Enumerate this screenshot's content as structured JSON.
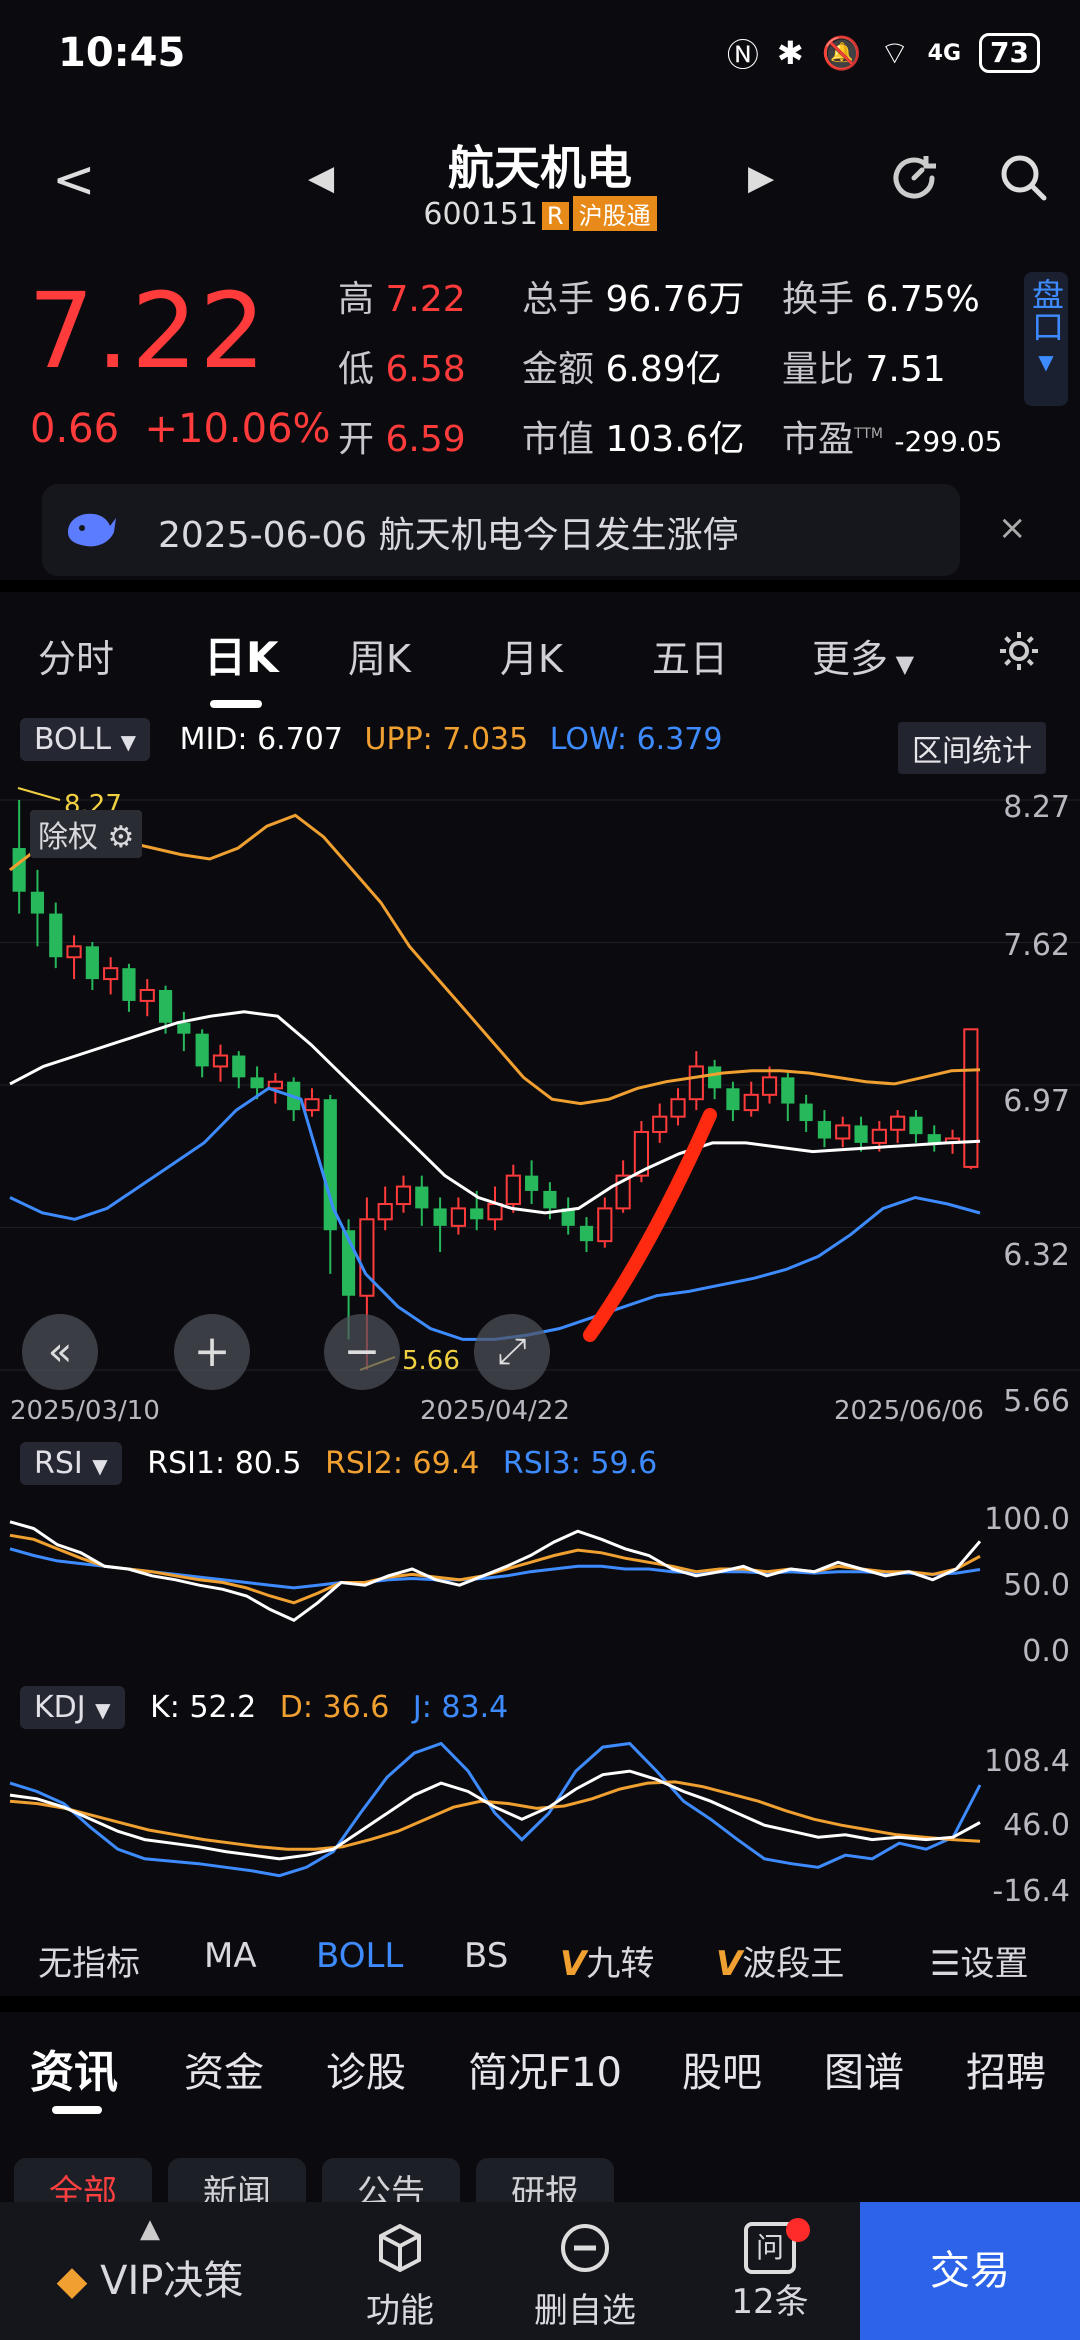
{
  "status": {
    "time": "10:45",
    "network": "4G",
    "battery": "73"
  },
  "header": {
    "name": "航天机电",
    "code": "600151",
    "tag_r": "R",
    "tag_connect": "沪股通"
  },
  "quote": {
    "price": "7.22",
    "change": "0.66",
    "change_pct": "+10.06%",
    "high_label": "高",
    "high": "7.22",
    "low_label": "低",
    "low": "6.58",
    "open_label": "开",
    "open": "6.59",
    "vol_label": "总手",
    "vol": "96.76万",
    "amount_label": "金额",
    "amount": "6.89亿",
    "mcap_label": "市值",
    "mcap": "103.6亿",
    "turnover_label": "换手",
    "turnover": "6.75%",
    "volratio_label": "量比",
    "volratio": "7.51",
    "pe_label": "市盈",
    "pe_sup": "TTM",
    "pe": "-299.05",
    "pankou": "盘口"
  },
  "notice": {
    "text": "2025-06-06 航天机电今日发生涨停",
    "close": "×"
  },
  "chart_tabs": [
    "分时",
    "日K",
    "周K",
    "月K",
    "五日",
    "更多"
  ],
  "boll": {
    "indicator": "BOLL",
    "mid_label": "MID:",
    "mid": "6.707",
    "upp_label": "UPP:",
    "upp": "7.035",
    "low_label": "LOW:",
    "low": "6.379",
    "range_btn": "区间统计",
    "chuquan": "除权",
    "max_mark": "8.27",
    "min_mark": "5.66",
    "y_ticks": [
      "8.27",
      "7.62",
      "6.97",
      "6.32",
      "5.66"
    ],
    "x_dates": [
      "2025/03/10",
      "2025/04/22",
      "2025/06/06"
    ]
  },
  "rsi": {
    "indicator": "RSI",
    "rsi1_label": "RSI1:",
    "rsi1": "80.5",
    "rsi2_label": "RSI2:",
    "rsi2": "69.4",
    "rsi3_label": "RSI3:",
    "rsi3": "59.6",
    "y_ticks": [
      "100.0",
      "50.0",
      "0.0"
    ]
  },
  "kdj": {
    "indicator": "KDJ",
    "k_label": "K:",
    "k": "52.2",
    "d_label": "D:",
    "d": "36.6",
    "j_label": "J:",
    "j": "83.4",
    "y_ticks": [
      "108.4",
      "46.0",
      "-16.4"
    ]
  },
  "indicator_bar": [
    "无指标",
    "MA",
    "BOLL",
    "BS",
    "九转",
    "波段王",
    "设置"
  ],
  "bottom_tabs": [
    "资讯",
    "资金",
    "诊股",
    "简况F10",
    "股吧",
    "图谱",
    "招聘"
  ],
  "sub_tabs": [
    "全部",
    "新闻",
    "公告",
    "研报"
  ],
  "nav": {
    "vip": "VIP决策",
    "func": "功能",
    "delete": "删自选",
    "ask": "12条",
    "ask_icon": "问",
    "trade": "交易"
  },
  "colors": {
    "up": "#ff3b3b",
    "down": "#26b85a",
    "upper": "#f0a030",
    "mid": "#ffffff",
    "lower": "#3d8bff",
    "accent": "#2c63e8"
  },
  "chart_data": {
    "type": "candlestick",
    "ylim": [
      5.66,
      8.27
    ],
    "candles": [
      [
        8.05,
        7.85,
        8.27,
        7.75
      ],
      [
        7.85,
        7.75,
        7.95,
        7.6
      ],
      [
        7.75,
        7.55,
        7.8,
        7.5
      ],
      [
        7.55,
        7.6,
        7.65,
        7.45
      ],
      [
        7.6,
        7.45,
        7.62,
        7.4
      ],
      [
        7.45,
        7.5,
        7.55,
        7.38
      ],
      [
        7.5,
        7.35,
        7.52,
        7.3
      ],
      [
        7.35,
        7.4,
        7.45,
        7.28
      ],
      [
        7.4,
        7.25,
        7.42,
        7.2
      ],
      [
        7.25,
        7.2,
        7.3,
        7.12
      ],
      [
        7.2,
        7.05,
        7.22,
        7.0
      ],
      [
        7.05,
        7.1,
        7.15,
        6.98
      ],
      [
        7.1,
        7.0,
        7.12,
        6.95
      ],
      [
        7.0,
        6.95,
        7.05,
        6.9
      ],
      [
        6.95,
        6.98,
        7.02,
        6.88
      ],
      [
        6.98,
        6.85,
        7.0,
        6.8
      ],
      [
        6.85,
        6.9,
        6.95,
        6.82
      ],
      [
        6.9,
        6.3,
        6.92,
        6.1
      ],
      [
        6.3,
        6.0,
        6.35,
        5.8
      ],
      [
        6.0,
        6.35,
        6.45,
        5.66
      ],
      [
        6.35,
        6.42,
        6.5,
        6.3
      ],
      [
        6.42,
        6.5,
        6.55,
        6.38
      ],
      [
        6.5,
        6.4,
        6.55,
        6.32
      ],
      [
        6.4,
        6.32,
        6.45,
        6.2
      ],
      [
        6.32,
        6.4,
        6.45,
        6.28
      ],
      [
        6.4,
        6.35,
        6.48,
        6.3
      ],
      [
        6.35,
        6.42,
        6.5,
        6.3
      ],
      [
        6.42,
        6.55,
        6.6,
        6.38
      ],
      [
        6.55,
        6.48,
        6.62,
        6.42
      ],
      [
        6.48,
        6.4,
        6.52,
        6.35
      ],
      [
        6.4,
        6.32,
        6.45,
        6.28
      ],
      [
        6.32,
        6.25,
        6.36,
        6.2
      ],
      [
        6.25,
        6.4,
        6.45,
        6.22
      ],
      [
        6.4,
        6.55,
        6.62,
        6.38
      ],
      [
        6.55,
        6.75,
        6.8,
        6.52
      ],
      [
        6.75,
        6.82,
        6.88,
        6.7
      ],
      [
        6.82,
        6.9,
        6.95,
        6.78
      ],
      [
        6.9,
        7.05,
        7.12,
        6.85
      ],
      [
        7.05,
        6.95,
        7.08,
        6.9
      ],
      [
        6.95,
        6.85,
        6.98,
        6.8
      ],
      [
        6.85,
        6.92,
        6.98,
        6.82
      ],
      [
        6.92,
        7.0,
        7.05,
        6.88
      ],
      [
        7.0,
        6.88,
        7.02,
        6.8
      ],
      [
        6.88,
        6.8,
        6.92,
        6.75
      ],
      [
        6.8,
        6.72,
        6.85,
        6.68
      ],
      [
        6.72,
        6.78,
        6.82,
        6.68
      ],
      [
        6.78,
        6.7,
        6.82,
        6.66
      ],
      [
        6.7,
        6.76,
        6.8,
        6.66
      ],
      [
        6.76,
        6.82,
        6.85,
        6.7
      ],
      [
        6.82,
        6.74,
        6.85,
        6.7
      ],
      [
        6.74,
        6.7,
        6.78,
        6.66
      ],
      [
        6.7,
        6.72,
        6.76,
        6.65
      ],
      [
        6.59,
        7.22,
        7.22,
        6.58
      ]
    ],
    "upper": [
      7.95,
      8.05,
      8.1,
      8.1,
      8.08,
      8.05,
      8.02,
      8.0,
      8.05,
      8.15,
      8.2,
      8.1,
      7.95,
      7.8,
      7.6,
      7.45,
      7.3,
      7.15,
      7.0,
      6.9,
      6.88,
      6.9,
      6.95,
      6.98,
      7.0,
      7.02,
      7.03,
      7.03,
      7.02,
      7.0,
      6.98,
      6.97,
      7.0,
      7.03,
      7.035
    ],
    "mid": [
      6.97,
      7.05,
      7.1,
      7.15,
      7.2,
      7.25,
      7.28,
      7.3,
      7.28,
      7.15,
      7.0,
      6.85,
      6.7,
      6.55,
      6.45,
      6.4,
      6.38,
      6.4,
      6.5,
      6.58,
      6.65,
      6.7,
      6.7,
      6.68,
      6.66,
      6.67,
      6.68,
      6.69,
      6.7,
      6.707
    ],
    "lower": [
      6.45,
      6.38,
      6.35,
      6.4,
      6.5,
      6.6,
      6.7,
      6.85,
      6.95,
      6.9,
      6.4,
      6.1,
      5.95,
      5.85,
      5.8,
      5.8,
      5.82,
      5.85,
      5.9,
      5.95,
      6.0,
      6.02,
      6.05,
      6.08,
      6.12,
      6.18,
      6.28,
      6.4,
      6.45,
      6.42,
      6.379
    ],
    "rsi1": [
      95,
      90,
      78,
      72,
      62,
      60,
      55,
      52,
      48,
      45,
      40,
      30,
      22,
      35,
      50,
      48,
      55,
      60,
      52,
      48,
      55,
      62,
      70,
      80,
      88,
      82,
      75,
      70,
      60,
      55,
      58,
      62,
      55,
      60,
      58,
      65,
      60,
      55,
      58,
      52,
      60,
      80.5
    ],
    "rsi2": [
      85,
      82,
      75,
      68,
      62,
      60,
      58,
      55,
      52,
      50,
      46,
      40,
      35,
      42,
      50,
      50,
      54,
      56,
      54,
      52,
      55,
      60,
      65,
      70,
      74,
      72,
      68,
      65,
      62,
      58,
      60,
      60,
      58,
      60,
      58,
      62,
      60,
      58,
      58,
      56,
      60,
      69.4
    ],
    "rsi3": [
      75,
      70,
      66,
      64,
      62,
      60,
      58,
      56,
      54,
      52,
      50,
      48,
      46,
      48,
      50,
      50,
      52,
      53,
      52,
      52,
      53,
      55,
      58,
      60,
      62,
      62,
      60,
      60,
      58,
      57,
      58,
      58,
      57,
      58,
      57,
      58,
      58,
      57,
      57,
      56,
      57,
      59.6
    ],
    "k": [
      75,
      72,
      65,
      55,
      45,
      38,
      35,
      32,
      28,
      25,
      22,
      25,
      30,
      45,
      60,
      75,
      85,
      78,
      65,
      55,
      65,
      80,
      92,
      95,
      88,
      78,
      70,
      60,
      50,
      45,
      40,
      42,
      38,
      40,
      38,
      40,
      52.2
    ],
    "d": [
      70,
      68,
      64,
      58,
      52,
      46,
      42,
      38,
      35,
      32,
      30,
      30,
      32,
      38,
      45,
      55,
      65,
      70,
      68,
      64,
      66,
      72,
      80,
      85,
      86,
      82,
      76,
      70,
      62,
      55,
      50,
      46,
      42,
      40,
      38,
      36.6
    ],
    "j": [
      85,
      78,
      68,
      48,
      30,
      22,
      20,
      18,
      15,
      12,
      8,
      15,
      28,
      60,
      90,
      110,
      118,
      95,
      60,
      38,
      60,
      95,
      115,
      118,
      95,
      70,
      55,
      38,
      22,
      18,
      15,
      25,
      22,
      35,
      30,
      40,
      83.4
    ]
  }
}
